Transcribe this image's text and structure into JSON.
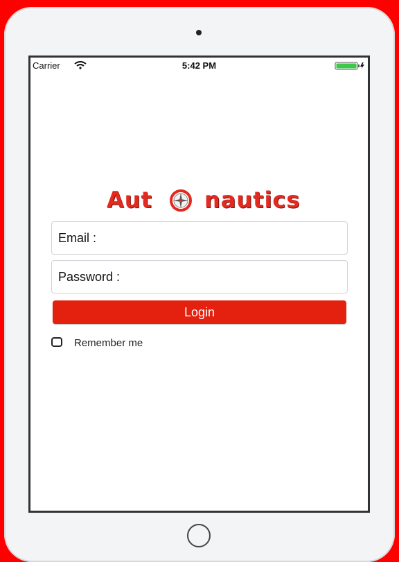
{
  "status_bar": {
    "carrier": "Carrier",
    "time": "5:42 PM"
  },
  "logo": {
    "text_left": "Aut",
    "text_right": "nautics",
    "icon": "compass-icon",
    "color": "#e22a20"
  },
  "form": {
    "email_label": "Email :",
    "email_value": "",
    "password_label": "Password :",
    "password_value": "",
    "login_label": "Login",
    "remember_label": "Remember me",
    "remember_checked": false
  },
  "colors": {
    "accent": "#e4200f",
    "background": "#ff0000"
  }
}
